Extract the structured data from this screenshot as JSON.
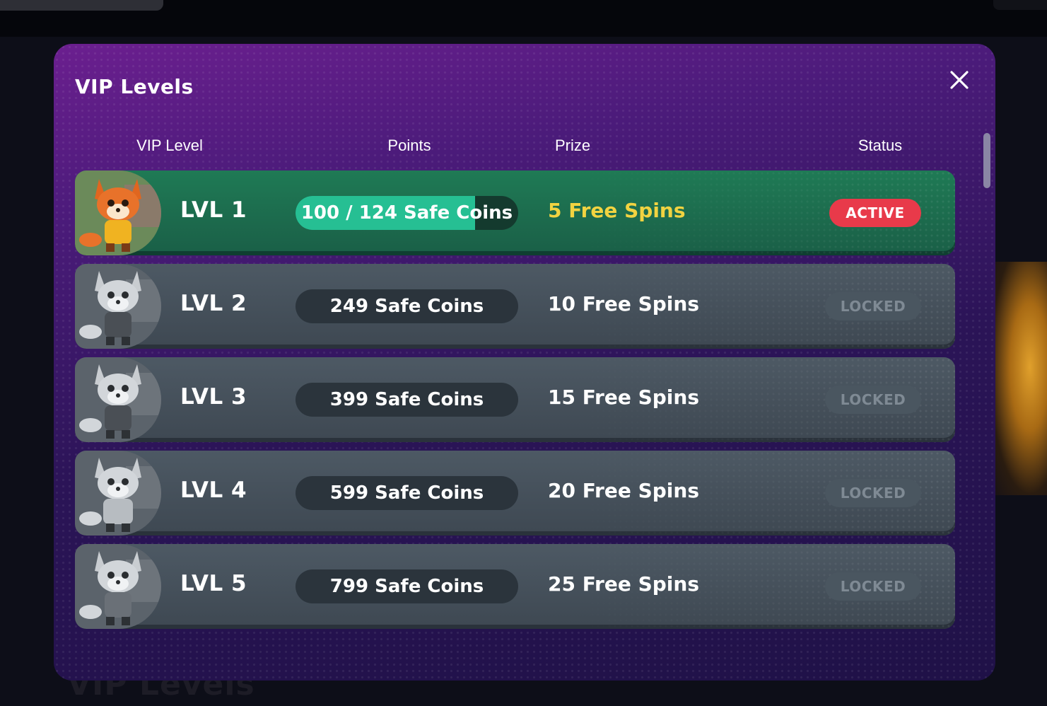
{
  "modal": {
    "title": "VIP Levels",
    "close_icon": "close-icon"
  },
  "columns": [
    "VIP Level",
    "Points",
    "Prize",
    "Status"
  ],
  "levels": [
    {
      "level": "LVL 1",
      "points": "100 / 124 Safe Coins",
      "progress": 0.806,
      "prize": "5 Free Spins",
      "status": "ACTIVE"
    },
    {
      "level": "LVL 2",
      "points": "249 Safe Coins",
      "prize": "10 Free Spins",
      "status": "LOCKED"
    },
    {
      "level": "LVL 3",
      "points": "399 Safe Coins",
      "prize": "15 Free Spins",
      "status": "LOCKED"
    },
    {
      "level": "LVL 4",
      "points": "599 Safe Coins",
      "prize": "20 Free Spins",
      "status": "LOCKED"
    },
    {
      "level": "LVL 5",
      "points": "799 Safe Coins",
      "prize": "25 Free Spins",
      "status": "LOCKED"
    }
  ],
  "background": {
    "title": "VIP Levels"
  },
  "colors": {
    "active_row": "#1f7a55",
    "locked_row": "#4d5964",
    "progress_fill": "#26bf93",
    "active_badge": "#e83a4a",
    "prize_active": "#f1d341"
  }
}
